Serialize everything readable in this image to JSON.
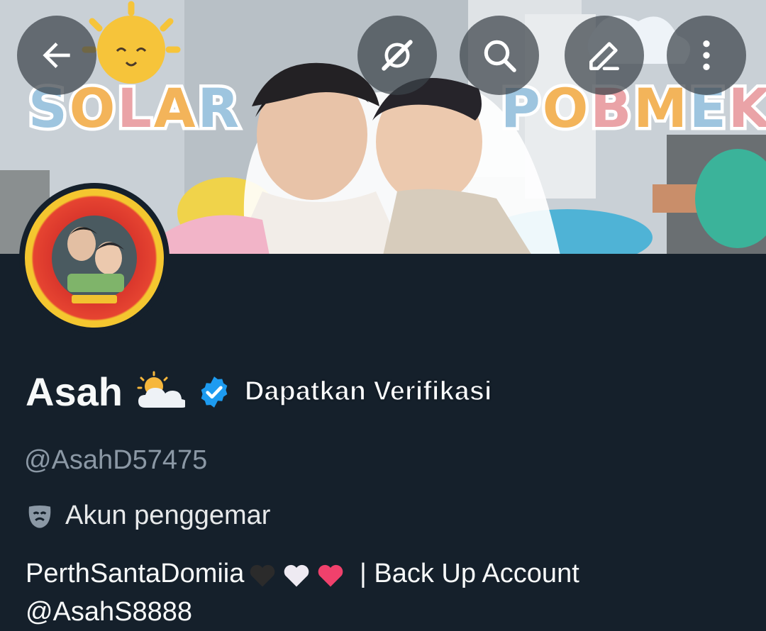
{
  "banner": {
    "left_word": "SOLAR",
    "right_word": "POBMEK"
  },
  "toolbar": {
    "back": "back-arrow",
    "grok": "grok-icon",
    "search": "search-icon",
    "edit": "edit-icon",
    "more": "more-vertical-icon"
  },
  "profile": {
    "name": "Asah",
    "name_emoji": "sun-behind-cloud",
    "get_verified_label": "Dapatkan Verifikasi",
    "handle": "@AsahD57475",
    "category": "Akun penggemar",
    "bio_prefix": "PerthSantaDomiia",
    "bio_hearts": [
      "black-heart",
      "white-heart",
      "red-heart"
    ],
    "bio_suffix": " | Back Up Account",
    "bio_mention": "@AsahS8888"
  },
  "colors": {
    "background": "#15202b",
    "verified_blue": "#1d9bf0",
    "secondary_text": "#8b98a5"
  }
}
